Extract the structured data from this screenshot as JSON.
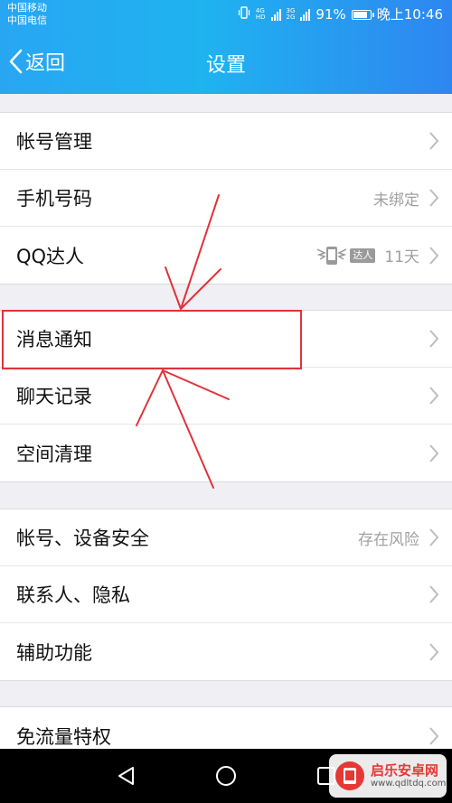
{
  "status_bar": {
    "carrier_1": "中国移动",
    "carrier_2": "中国电信",
    "net_1_top": "4G",
    "net_1_bottom": "HD",
    "net_2_top": "3G",
    "net_2_bottom": "2G",
    "battery_percent": "91%",
    "battery_level": 0.91,
    "time": "晚上10:46"
  },
  "nav": {
    "back_label": "返回",
    "title": "设置"
  },
  "groups": [
    {
      "items": [
        {
          "label": "帐号管理",
          "value": ""
        },
        {
          "label": "手机号码",
          "value": "未绑定"
        },
        {
          "label": "QQ达人",
          "badge_text": "达人",
          "value": "11天"
        }
      ]
    },
    {
      "items": [
        {
          "label": "消息通知",
          "value": ""
        },
        {
          "label": "聊天记录",
          "value": ""
        },
        {
          "label": "空间清理",
          "value": ""
        }
      ]
    },
    {
      "items": [
        {
          "label": "帐号、设备安全",
          "value": "存在风险"
        },
        {
          "label": "联系人、隐私",
          "value": ""
        },
        {
          "label": "辅助功能",
          "value": ""
        }
      ]
    },
    {
      "items": [
        {
          "label": "免流量特权",
          "value": ""
        }
      ]
    }
  ],
  "watermark": {
    "title": "启乐安卓网",
    "url": "www.qdltdq.com"
  },
  "colors": {
    "header_start": "#28a6f2",
    "header_end": "#2e86f0",
    "annotation_red": "#e0323a"
  }
}
